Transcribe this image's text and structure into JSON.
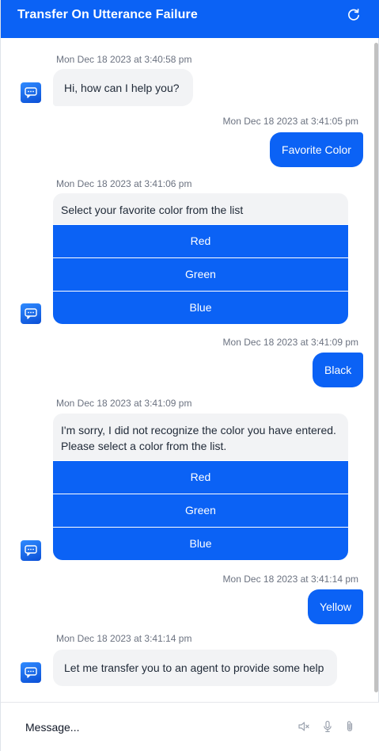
{
  "header": {
    "title": "Transfer On Utterance Failure",
    "refresh_icon": "refresh-icon"
  },
  "messages": {
    "m1": {
      "time": "Mon Dec 18 2023 at 3:40:58 pm",
      "text": "Hi, how can I help you?"
    },
    "m2": {
      "time": "Mon Dec 18 2023 at 3:41:05 pm",
      "text": "Favorite Color"
    },
    "m3": {
      "time": "Mon Dec 18 2023 at 3:41:06 pm",
      "text": "Select your favorite color from the list",
      "options": [
        "Red",
        "Green",
        "Blue"
      ]
    },
    "m4": {
      "time": "Mon Dec 18 2023 at 3:41:09 pm",
      "text": "Black"
    },
    "m5": {
      "time": "Mon Dec 18 2023 at 3:41:09 pm",
      "text": "I'm sorry, I did not recognize the color you have entered. Please select a color from the list.",
      "options": [
        "Red",
        "Green",
        "Blue"
      ]
    },
    "m6": {
      "time": "Mon Dec 18 2023 at 3:41:14 pm",
      "text": "Yellow"
    },
    "m7": {
      "time": "Mon Dec 18 2023 at 3:41:14 pm",
      "text": "Let me transfer you to an agent to provide some help"
    }
  },
  "composer": {
    "placeholder": "Message..."
  },
  "colors": {
    "brand": "#0b62f5",
    "bot_bubble": "#f2f3f5",
    "timestamp": "#6b7280"
  }
}
